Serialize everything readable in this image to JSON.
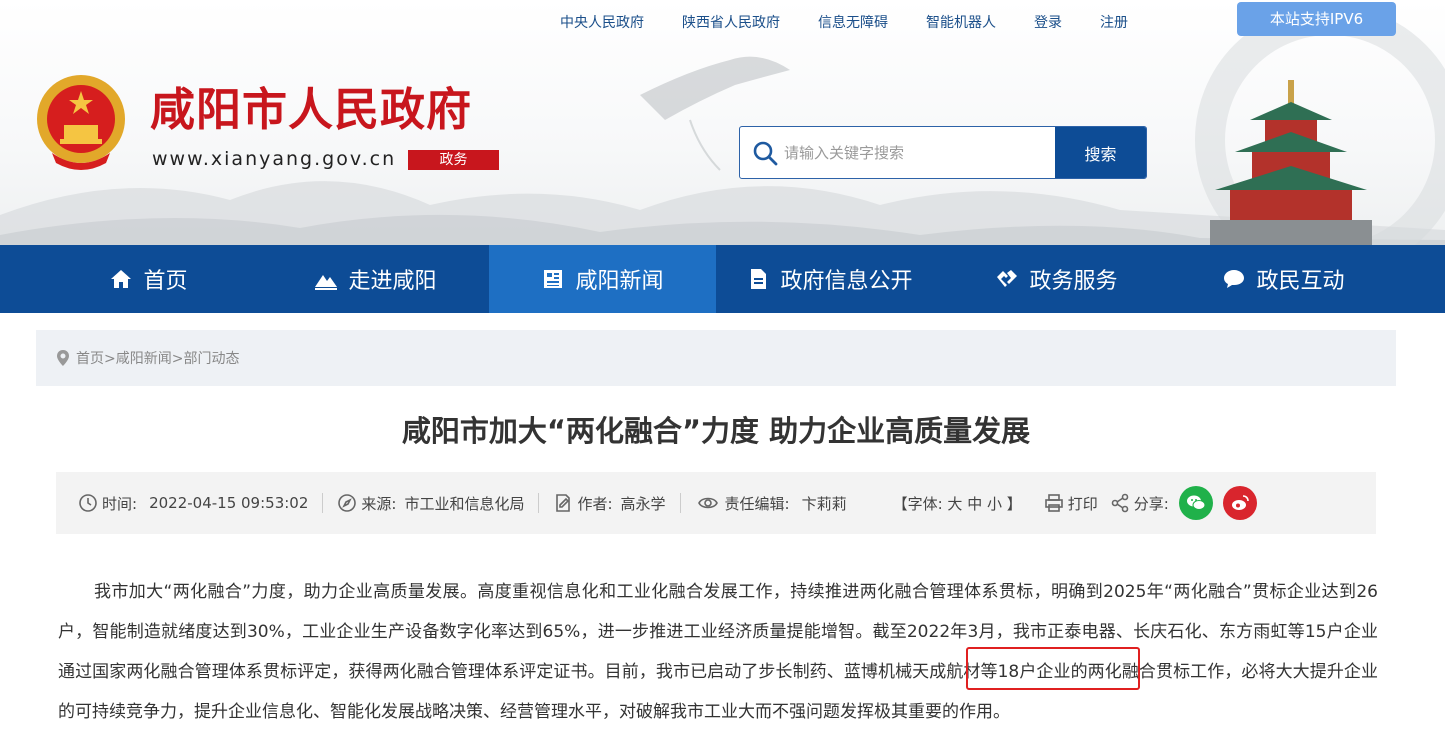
{
  "top_links": [
    "中央人民政府",
    "陕西省人民政府",
    "信息无障碍",
    "智能机器人",
    "登录",
    "注册"
  ],
  "ipv6_label": "本站支持IPV6",
  "site": {
    "title": "咸阳市人民政府",
    "url": "www.xianyang.gov.cn",
    "badge": "政务"
  },
  "search": {
    "placeholder": "请输入关键字搜索",
    "button": "搜索"
  },
  "nav": [
    {
      "label": "首页",
      "icon": "home-icon",
      "active": false
    },
    {
      "label": "走进咸阳",
      "icon": "mountain-icon",
      "active": false
    },
    {
      "label": "咸阳新闻",
      "icon": "news-icon",
      "active": true
    },
    {
      "label": "政府信息公开",
      "icon": "document-icon",
      "active": false
    },
    {
      "label": "政务服务",
      "icon": "handshake-icon",
      "active": false
    },
    {
      "label": "政民互动",
      "icon": "chat-icon",
      "active": false
    }
  ],
  "breadcrumb": "首页>咸阳新闻>部门动态",
  "article": {
    "title": "咸阳市加大“两化融合”力度 助力企业高质量发展",
    "meta": {
      "time_label": "时间:",
      "time": "2022-04-15 09:53:02",
      "source_label": "来源:",
      "source": "市工业和信息化局",
      "author_label": "作者:",
      "author": "高永学",
      "editor_label": "责任编辑:",
      "editor": "卞莉莉",
      "font_size_label": "【字体: 大 中 小 】",
      "print_label": "打印",
      "share_label": "分享:"
    },
    "body": "我市加大“两化融合”力度，助力企业高质量发展。高度重视信息化和工业化融合发展工作，持续推进两化融合管理体系贯标，明确到2025年“两化融合”贯标企业达到26户，智能制造就绪度达到30%，工业企业生产设备数字化率达到65%，进一步推进工业经济质量提能增智。截至2022年3月，我市正泰电器、长庆石化、东方雨虹等15户企业通过国家两化融合管理体系贯标评定，获得两化融合管理体系评定证书。目前，我市已启动了步长制药、蓝博机械天成航材等18户企业的两化融合贯标工作，必将大大提升企业的可持续竞争力，提升企业信息化、智能化发展战略决策、经营管理水平，对破解我市工业大而不强问题发挥极其重要的作用。"
  },
  "colors": {
    "brand_red": "#c8161d",
    "nav_blue": "#0d4c96",
    "nav_active": "#1e6fc3",
    "wechat_green": "#20b14a",
    "weibo_red": "#d9252d",
    "highlight_red": "#e02020"
  }
}
